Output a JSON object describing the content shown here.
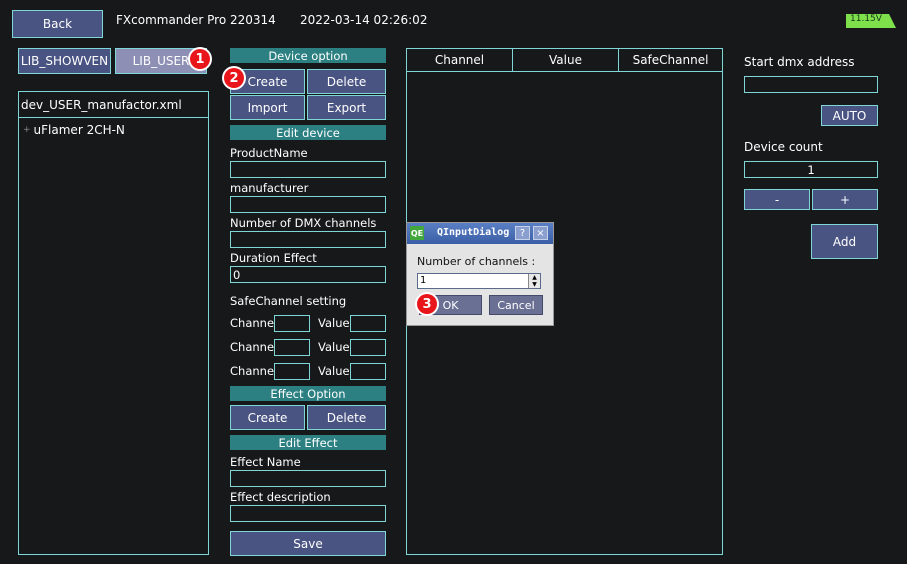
{
  "header": {
    "back_label": "Back",
    "app_title": "FXcommander Pro 220314",
    "datetime": "2022-03-14 02:26:02",
    "battery": "11.15V"
  },
  "lib_tabs": {
    "showven": "LIB_SHOWVEN",
    "user": "LIB_USER"
  },
  "file_panel": {
    "filename": "dev_USER_manufactor.xml",
    "tree_items": [
      "uFlamer 2CH-N"
    ]
  },
  "device_option": {
    "header": "Device option",
    "create": "Create",
    "delete": "Delete",
    "import": "Import",
    "export": "Export"
  },
  "edit_device": {
    "header": "Edit device",
    "product_name_label": "ProductName",
    "product_name_value": "",
    "manufacturer_label": "manufacturer",
    "manufacturer_value": "",
    "dmx_channels_label": "Number of DMX channels",
    "dmx_channels_value": "",
    "duration_label": "Duration Effect",
    "duration_value": "0"
  },
  "safe_channel": {
    "label": "SafeChannel setting",
    "channel_label": "Channel",
    "value_label": "Value"
  },
  "effect_option": {
    "header": "Effect Option",
    "create": "Create",
    "delete": "Delete"
  },
  "edit_effect": {
    "header": "Edit Effect",
    "name_label": "Effect Name",
    "name_value": "",
    "desc_label": "Effect description",
    "desc_value": "",
    "save": "Save"
  },
  "channel_table": {
    "columns": [
      "Channel",
      "Value",
      "SafeChannel"
    ]
  },
  "right_panel": {
    "start_dmx_label": "Start dmx address",
    "start_dmx_value": "",
    "auto": "AUTO",
    "device_count_label": "Device count",
    "device_count_value": "1",
    "minus": "-",
    "plus": "+",
    "add": "Add"
  },
  "dialog": {
    "icon_text": "QE",
    "title": "QInputDialog",
    "help": "?",
    "close": "×",
    "prompt": "Number of channels :",
    "value": "1",
    "ok": "OK",
    "cancel": "Cancel"
  },
  "badges": [
    "1",
    "2",
    "3"
  ],
  "colors": {
    "background": "#16181a",
    "button": "#4a5482",
    "selected_tab": "#8e8fb5",
    "border": "#7fd6d6",
    "section_header": "#2c8082",
    "badge": "#e8161b",
    "battery": "#7ee04a"
  }
}
